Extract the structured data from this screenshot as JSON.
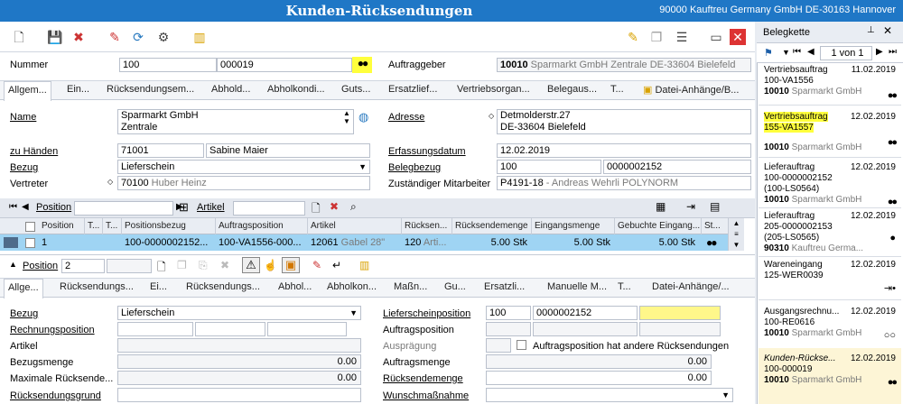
{
  "title": "Kunden-Rücksendungen",
  "company": "90000  Kauftreu Germany GmbH DE-30163 Hannover",
  "icons": {
    "new": "new-doc-icon",
    "save": "save-icon",
    "delete": "delete-icon",
    "edit": "edit-icon",
    "refresh": "refresh-icon",
    "tools": "tools-icon",
    "chart": "chart-icon",
    "note": "note-icon",
    "copy": "copy-icon",
    "list": "list-icon",
    "window": "window-icon",
    "close": "close-icon"
  },
  "header": {
    "nummer_label": "Nummer",
    "nummer_value": "100",
    "nummer_value2": "000019",
    "auftraggeber_label": "Auftraggeber",
    "auftraggeber_value": "10010",
    "auftraggeber_text": "Sparmarkt GmbH Zentrale DE-33604 Bielefeld"
  },
  "tabs1": [
    "Allgem...",
    "Ein...",
    "Rücksendungsem...",
    "Abhold...",
    "Abholkondi...",
    "Guts...",
    "Ersatzlief...",
    "Vertriebsorgan...",
    "Belegaus...",
    "T...",
    "Datei-Anhänge/B..."
  ],
  "form": {
    "name_label": "Name",
    "name1": "Sparmarkt GmbH",
    "name2": "Zentrale",
    "adresse_label": "Adresse",
    "adresse1": "Detmolderstr.27",
    "adresse2": "DE-33604 Bielefeld",
    "zuhaenden_label": "zu Händen",
    "zuhaenden_nr": "71001",
    "zuhaenden_name": "Sabine Maier",
    "erfassung_label": "Erfassungsdatum",
    "erfassung_value": "12.02.2019",
    "bezug_label": "Bezug",
    "bezug_value": "Lieferschein",
    "belegbezug_label": "Belegbezug",
    "belegbezug_1": "100",
    "belegbezug_2": "0000002152",
    "vertreter_label": "Vertreter",
    "vertreter_nr": "70100",
    "vertreter_name": "Huber Heinz",
    "zustaendig_label": "Zuständiger Mitarbeiter",
    "zustaendig_nr": "P4191-18",
    "zustaendig_name": "- Andreas Wehrli POLYNORM"
  },
  "gridtb": {
    "position_label": "Position",
    "artikel_label": "Artikel"
  },
  "grid": {
    "headers": [
      "Position",
      "T...",
      "T...",
      "Positionsbezug",
      "Auftragsposition",
      "Artikel",
      "Rücksen...",
      "Rücksendemenge",
      "Eingangsmenge",
      "Gebuchte Eingang...",
      "St..."
    ],
    "row": {
      "position": "1",
      "bezug": "100-0000002152...",
      "auftrag": "100-VA1556-000...",
      "artikel_nr": "12061",
      "artikel_txt": "Gabel  28\"",
      "ruecksen_nr": "120",
      "ruecksen_txt": "Arti...",
      "ruecksendemenge": "5.00 Stk",
      "eingangsmenge": "5.00 Stk",
      "gebucht": "5.00 Stk"
    }
  },
  "pos": {
    "label": "Position",
    "value": "2"
  },
  "tabs2": [
    "Allge...",
    "Rücksendungs...",
    "Ei...",
    "Rücksendungs...",
    "Abhol...",
    "Abholkon...",
    "Maßn...",
    "Gu...",
    "Ersatzli...",
    "Manuelle M...",
    "T...",
    "Datei-Anhänge/..."
  ],
  "detail": {
    "bezug_label": "Bezug",
    "bezug_value": "Lieferschein",
    "rechnung_label": "Rechnungsposition",
    "artikel_label": "Artikel",
    "bezugsmenge_label": "Bezugsmenge",
    "bezugsmenge_value": "0.00",
    "maxrueck_label": "Maximale Rücksende...",
    "maxrueck_value": "0.00",
    "grund_label": "Rücksendungsgrund",
    "lsp_label": "Lieferscheinposition",
    "lsp_1": "100",
    "lsp_2": "0000002152",
    "ap_label": "Auftragsposition",
    "auspr_label": "Ausprägung",
    "ap_other_label": "Auftragsposition hat andere Rücksendungen",
    "am_label": "Auftragsmenge",
    "am_value": "0.00",
    "rm_label": "Rücksendemenge",
    "rm_value": "0.00",
    "wm_label": "Wunschmaßnahme"
  },
  "sidebar": {
    "title": "Belegkette",
    "pager": "1 von 1",
    "cards": [
      {
        "type": "Vertriebsauftrag",
        "date": "11.02.2019",
        "nr": "100-VA1556",
        "extra": "",
        "cust_nr": "10010",
        "cust": "Sparmarkt GmbH"
      },
      {
        "type": "Vertriebsauftrag",
        "date": "12.02.2019",
        "nr": "155-VA1557",
        "extra": "",
        "cust_nr": "10010",
        "cust": "Sparmarkt GmbH"
      },
      {
        "type": "Lieferauftrag",
        "date": "12.02.2019",
        "nr": "100-0000002152",
        "extra": "(100-LS0564)",
        "cust_nr": "10010",
        "cust": "Sparmarkt GmbH"
      },
      {
        "type": "Lieferauftrag",
        "date": "12.02.2019",
        "nr": "205-0000002153",
        "extra": "(205-LS0565)",
        "cust_nr": "90310",
        "cust": "Kauftreu Germa..."
      },
      {
        "type": "Wareneingang",
        "date": "12.02.2019",
        "nr": "125-WER0039",
        "extra": "",
        "cust_nr": "",
        "cust": ""
      },
      {
        "type": "Ausgangsrechnu...",
        "date": "12.02.2019",
        "nr": "100-RE0616",
        "extra": "",
        "cust_nr": "10010",
        "cust": "Sparmarkt GmbH"
      },
      {
        "type": "Kunden-Rückse...",
        "date": "12.02.2019",
        "nr": "100-000019",
        "extra": "",
        "cust_nr": "10010",
        "cust": "Sparmarkt GmbH"
      }
    ]
  }
}
